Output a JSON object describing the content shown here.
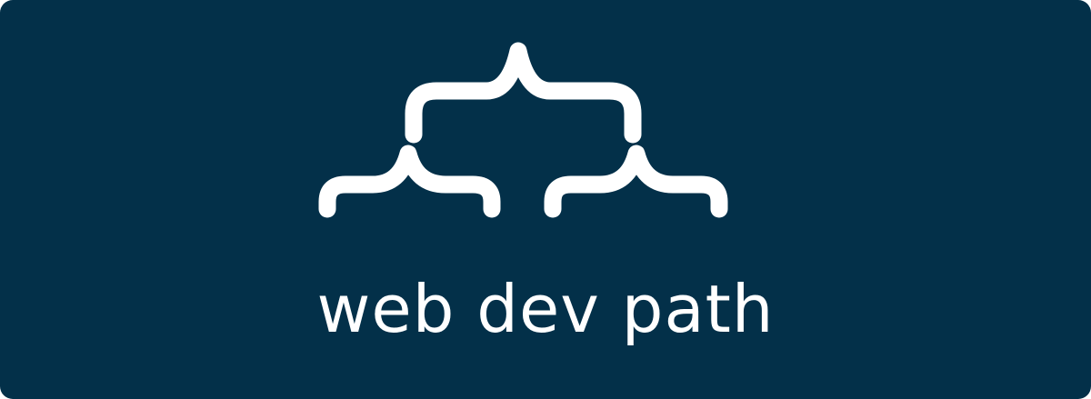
{
  "brand": {
    "wordmark": "web dev path",
    "logo_icon": "curly-brace-tree-icon"
  },
  "colors": {
    "background": "#033049",
    "foreground": "#ffffff"
  }
}
